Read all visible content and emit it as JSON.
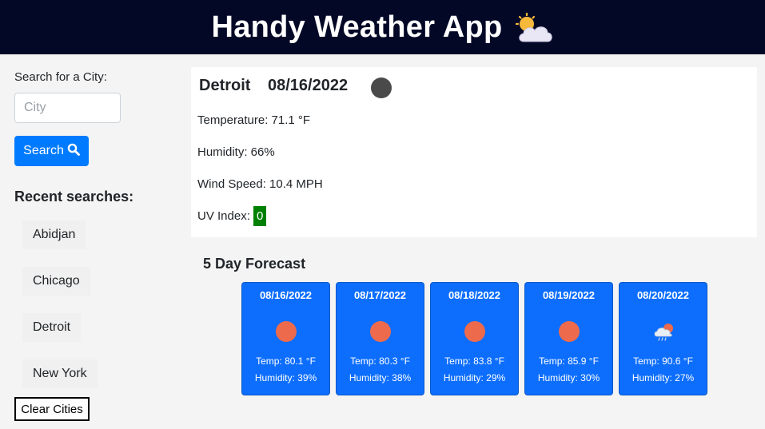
{
  "header": {
    "title": "Handy Weather App",
    "icon": "sun-behind-cloud-icon"
  },
  "sidebar": {
    "search_label": "Search for a City:",
    "city_placeholder": "City",
    "search_button": "Search",
    "recent_title": "Recent searches:",
    "recent": [
      "Abidjan",
      "Chicago",
      "Detroit",
      "New York"
    ],
    "clear_button": "Clear Cities"
  },
  "current": {
    "city": "Detroit",
    "date": "08/16/2022",
    "icon": "dark-circle-icon",
    "temperature": "Temperature: 71.1 °F",
    "humidity": "Humidity: 66%",
    "wind": "Wind Speed: 10.4 MPH",
    "uv_label": "UV Index: ",
    "uv_value": "0",
    "uv_color": "#008000"
  },
  "forecast": {
    "title": "5 Day Forecast",
    "days": [
      {
        "date": "08/16/2022",
        "icon": "sun-icon",
        "temp": "Temp: 80.1 °F",
        "humidity": "Humidity: 39%"
      },
      {
        "date": "08/17/2022",
        "icon": "sun-icon",
        "temp": "Temp: 80.3 °F",
        "humidity": "Humidity: 38%"
      },
      {
        "date": "08/18/2022",
        "icon": "sun-icon",
        "temp": "Temp: 83.8 °F",
        "humidity": "Humidity: 29%"
      },
      {
        "date": "08/19/2022",
        "icon": "sun-icon",
        "temp": "Temp: 85.9 °F",
        "humidity": "Humidity: 30%"
      },
      {
        "date": "08/20/2022",
        "icon": "rain-cloud-sun-icon",
        "temp": "Temp: 90.6 °F",
        "humidity": "Humidity: 27%"
      }
    ]
  },
  "colors": {
    "header_bg": "#030826",
    "primary": "#007bff",
    "card_bg": "#0d6efd",
    "sun": "#ee6a4c"
  }
}
